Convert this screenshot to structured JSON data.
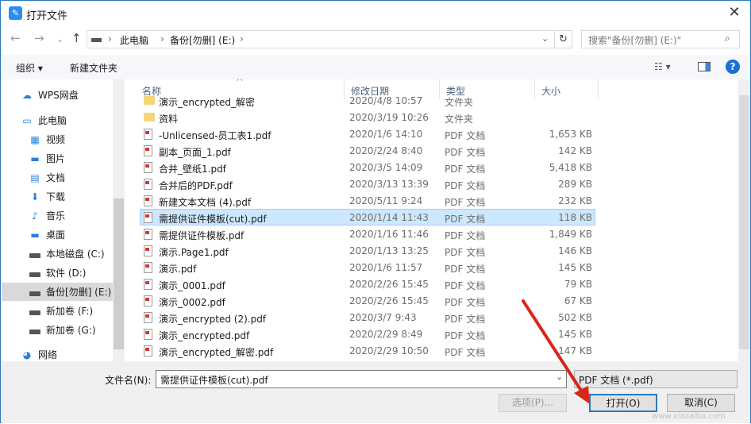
{
  "window": {
    "title": "打开文件",
    "close": "✕"
  },
  "nav": {
    "back": "←",
    "forward": "→",
    "recent": "⌄",
    "up": "↑",
    "crumbs": [
      "此电脑",
      "备份[勿删] (E:)"
    ],
    "sep": "›",
    "refresh": "↻",
    "search_placeholder": "搜索\"备份[勿删] (E:)\""
  },
  "toolbar": {
    "organize": "组织 ▾",
    "new_folder": "新建文件夹",
    "view": "☷ ▾",
    "help": "?"
  },
  "sidebar": {
    "items": [
      {
        "label": "WPS网盘",
        "icon": "cloud-icon"
      },
      {
        "label": "此电脑",
        "icon": "computer-icon"
      },
      {
        "label": "视频",
        "icon": "video-icon"
      },
      {
        "label": "图片",
        "icon": "picture-icon"
      },
      {
        "label": "文档",
        "icon": "document-icon"
      },
      {
        "label": "下载",
        "icon": "download-icon"
      },
      {
        "label": "音乐",
        "icon": "music-icon"
      },
      {
        "label": "桌面",
        "icon": "desktop-icon"
      },
      {
        "label": "本地磁盘 (C:)",
        "icon": "drive-icon"
      },
      {
        "label": "软件 (D:)",
        "icon": "drive-icon"
      },
      {
        "label": "备份[勿删] (E:)",
        "icon": "drive-icon"
      },
      {
        "label": "新加卷 (F:)",
        "icon": "drive-icon"
      },
      {
        "label": "新加卷 (G:)",
        "icon": "drive-icon"
      },
      {
        "label": "网络",
        "icon": "network-icon"
      }
    ]
  },
  "columns": {
    "name": "名称",
    "date": "修改日期",
    "type": "类型",
    "size": "大小"
  },
  "files": [
    {
      "name": "演示_encrypted_解密",
      "date": "2020/4/8 10:57",
      "type": "文件夹",
      "size": "",
      "folder": true
    },
    {
      "name": "资料",
      "date": "2020/3/19 10:26",
      "type": "文件夹",
      "size": "",
      "folder": true
    },
    {
      "name": "-Unlicensed-员工表1.pdf",
      "date": "2020/1/6 14:10",
      "type": "PDF 文档",
      "size": "1,653 KB"
    },
    {
      "name": "副本_页面_1.pdf",
      "date": "2020/2/24 8:40",
      "type": "PDF 文档",
      "size": "142 KB"
    },
    {
      "name": "合并_壁纸1.pdf",
      "date": "2020/3/5 14:09",
      "type": "PDF 文档",
      "size": "5,418 KB"
    },
    {
      "name": "合并后的PDF.pdf",
      "date": "2020/3/13 13:39",
      "type": "PDF 文档",
      "size": "289 KB"
    },
    {
      "name": "新建文本文档 (4).pdf",
      "date": "2020/5/11 9:24",
      "type": "PDF 文档",
      "size": "232 KB"
    },
    {
      "name": "需提供证件模板(cut).pdf",
      "date": "2020/1/14 11:43",
      "type": "PDF 文档",
      "size": "118 KB",
      "selected": true
    },
    {
      "name": "需提供证件模板.pdf",
      "date": "2020/1/16 11:46",
      "type": "PDF 文档",
      "size": "1,849 KB"
    },
    {
      "name": "演示.Page1.pdf",
      "date": "2020/1/13 13:25",
      "type": "PDF 文档",
      "size": "146 KB"
    },
    {
      "name": "演示.pdf",
      "date": "2020/1/6 11:57",
      "type": "PDF 文档",
      "size": "145 KB"
    },
    {
      "name": "演示_0001.pdf",
      "date": "2020/2/26 15:45",
      "type": "PDF 文档",
      "size": "79 KB"
    },
    {
      "name": "演示_0002.pdf",
      "date": "2020/2/26 15:45",
      "type": "PDF 文档",
      "size": "67 KB"
    },
    {
      "name": "演示_encrypted (2).pdf",
      "date": "2020/3/7 9:43",
      "type": "PDF 文档",
      "size": "502 KB"
    },
    {
      "name": "演示_encrypted.pdf",
      "date": "2020/2/29 8:49",
      "type": "PDF 文档",
      "size": "145 KB"
    },
    {
      "name": "演示_encrypted_解密.pdf",
      "date": "2020/2/29 10:50",
      "type": "PDF 文档",
      "size": "147 KB"
    }
  ],
  "footer": {
    "filename_label": "文件名(N):",
    "filename": "需提供证件模板(cut).pdf",
    "filter": "PDF 文档 (*.pdf)",
    "options": "选项(P)...",
    "open": "打开(O)",
    "cancel": "取消(C)"
  },
  "watermark": "www.xiazaiba.com"
}
